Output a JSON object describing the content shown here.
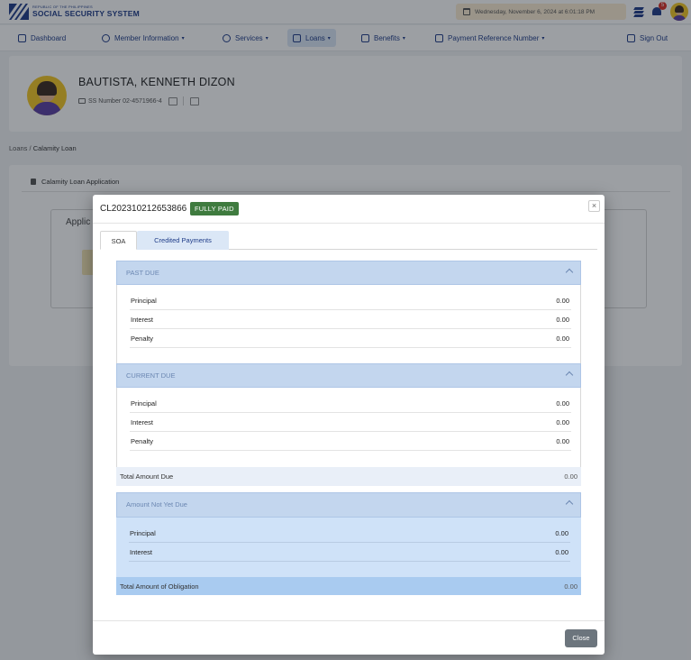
{
  "header": {
    "logo_small": "REPUBLIC OF THE PHILIPPINES",
    "logo_big": "SOCIAL SECURITY SYSTEM",
    "datetime": "Wednesday, November 6, 2024 at 6:01:18 PM",
    "notification_count": "5"
  },
  "nav": {
    "items": [
      {
        "label": "Dashboard"
      },
      {
        "label": "Member Information"
      },
      {
        "label": "Services"
      },
      {
        "label": "Loans"
      },
      {
        "label": "Benefits"
      },
      {
        "label": "Payment Reference Number"
      },
      {
        "label": "Sign Out"
      }
    ]
  },
  "member": {
    "name": "BAUTISTA, KENNETH DIZON",
    "ss_number": "SS Number 02-4571966-4"
  },
  "breadcrumb": {
    "parent": "Loans",
    "separator": " / ",
    "current": "Calamity Loan"
  },
  "page": {
    "section_title": "Calamity Loan Application",
    "inner_title": "Applic"
  },
  "modal": {
    "loan_id": "CL202310212653866",
    "status_badge": "FULLY PAID",
    "close_x": "×",
    "tabs": [
      {
        "label": "SOA"
      },
      {
        "label": "Credited Payments"
      }
    ],
    "past_due": {
      "title": "PAST DUE",
      "rows": [
        {
          "label": "Principal",
          "value": "0.00"
        },
        {
          "label": "Interest",
          "value": "0.00"
        },
        {
          "label": "Penalty",
          "value": "0.00"
        }
      ]
    },
    "current_due": {
      "title": "CURRENT DUE",
      "rows": [
        {
          "label": "Principal",
          "value": "0.00"
        },
        {
          "label": "Interest",
          "value": "0.00"
        },
        {
          "label": "Penalty",
          "value": "0.00"
        }
      ]
    },
    "total_amount_due": {
      "label": "Total Amount Due",
      "value": "0.00"
    },
    "not_yet_due": {
      "title": "Amount Not Yet Due",
      "rows": [
        {
          "label": "Principal",
          "value": "0.00"
        },
        {
          "label": "Interest",
          "value": "0.00"
        }
      ]
    },
    "total_obligation": {
      "label": "Total Amount of Obligation",
      "value": "0.00"
    },
    "close_label": "Close"
  }
}
